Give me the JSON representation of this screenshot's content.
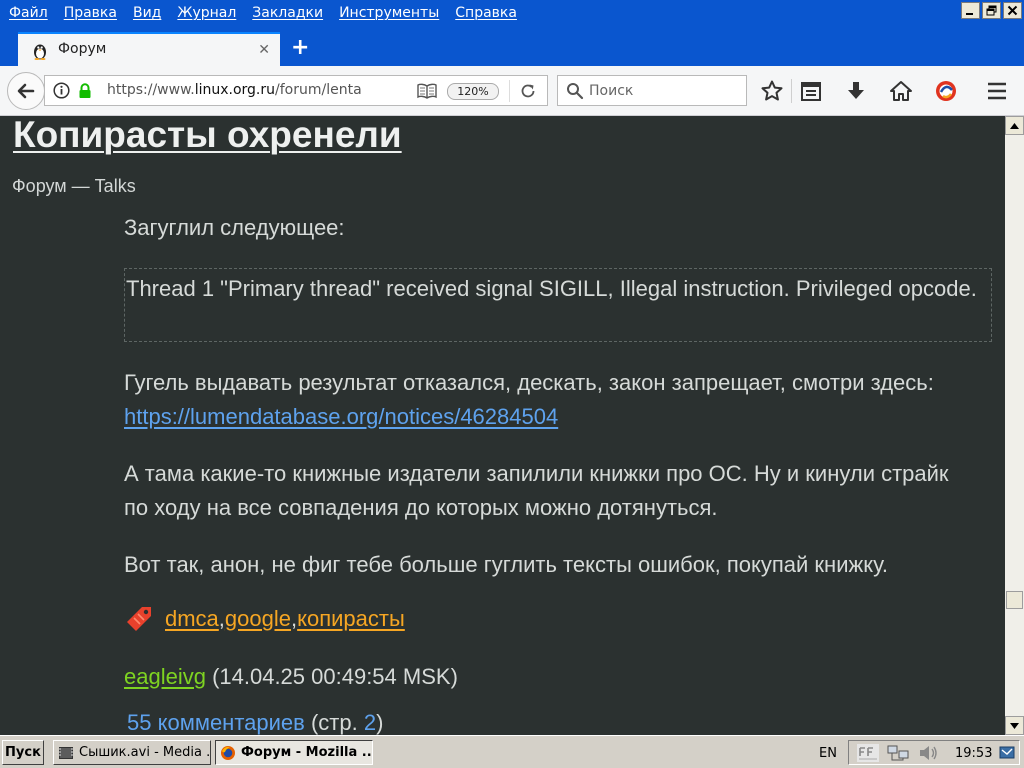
{
  "menubar": {
    "items": [
      "Файл",
      "Правка",
      "Вид",
      "Журнал",
      "Закладки",
      "Инструменты",
      "Справка"
    ]
  },
  "tab": {
    "title": "Форум",
    "close": "✕"
  },
  "newtab": {
    "label": "+"
  },
  "navbar": {
    "url_prefix": "https://www.",
    "url_host": "linux.org.ru",
    "url_path": "/forum/lenta",
    "zoom": "120%",
    "search_placeholder": "Поиск"
  },
  "article": {
    "title": "Копирасты охренели",
    "breadcrumb": "Форум — Talks",
    "intro": "Загуглил следующее:",
    "quote": "Thread 1 \"Primary thread\" received signal SIGILL, Illegal instruction. Privileged opcode.",
    "p2_text": "Гугель выдавать результат отказался, дескать, закон запрещает, смотри здесь: ",
    "p2_link": "https://lumendatabase.org/notices/46284504",
    "p3": "А тама какие-то книжные издатели запилили книжки про ОС. Ну и кинули страйк по ходу на все совпадения до которых можно дотянуться.",
    "p4": "Вот так, анон, не фиг тебе больше гуглить тексты ошибок, покупай книжку.",
    "tags": [
      "dmca",
      "google",
      "копирасты"
    ],
    "tag_sep": ", ",
    "author": "eagleivg",
    "timestamp": " (14.04.25 00:49:54 MSK)",
    "comments_link": "55 комментариев",
    "comments_pages_prefix": " (стр. ",
    "comments_page": "2",
    "comments_pages_suffix": ")"
  },
  "taskbar": {
    "start": "Пуск",
    "buttons": [
      {
        "label": "Сышик.avi - Media ..."
      },
      {
        "label": "Форум - Mozilla ..."
      }
    ],
    "lang": "EN",
    "clock": "19:53"
  }
}
